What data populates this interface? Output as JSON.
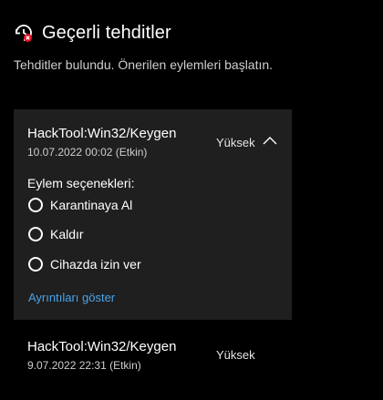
{
  "header": {
    "icon": "shield-warning-icon",
    "title": "Geçerli tehditler"
  },
  "subtitle": "Tehditler bulundu. Önerilen eylemleri başlatın.",
  "threats": [
    {
      "name": "HackTool:Win32/Keygen",
      "date": "10.07.2022 00:02 (Etkin)",
      "severity": "Yüksek",
      "expanded": true,
      "actions_label": "Eylem seçenekleri:",
      "actions": [
        "Karantinaya Al",
        "Kaldır",
        "Cihazda izin ver"
      ],
      "details_link": "Ayrıntıları göster"
    },
    {
      "name": "HackTool:Win32/Keygen",
      "date": "9.07.2022 22:31 (Etkin)",
      "severity": "Yüksek",
      "expanded": false
    }
  ],
  "colors": {
    "background": "#000000",
    "card": "#1f1f1f",
    "link": "#4aa3e8",
    "icon_accent": "#e81123"
  }
}
